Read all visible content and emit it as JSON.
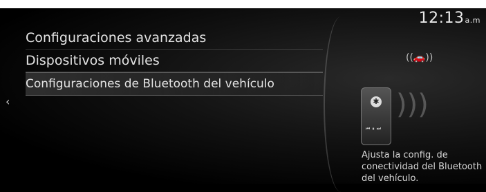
{
  "clock": {
    "time": "12:13",
    "ampm": "a.m"
  },
  "menu": {
    "items": [
      {
        "label": "Configuraciones avanzadas"
      },
      {
        "label": "Dispositivos móviles"
      },
      {
        "label": "Configuraciones de Bluetooth del vehículo"
      }
    ]
  },
  "nav": {
    "back_icon": "chevron-left-icon"
  },
  "illustration": {
    "phone_icon": "bluetooth-icon",
    "car_icon": "car-icon"
  },
  "hint": {
    "text": "Ajusta la config. de conectividad del Bluetooth del vehículo."
  }
}
